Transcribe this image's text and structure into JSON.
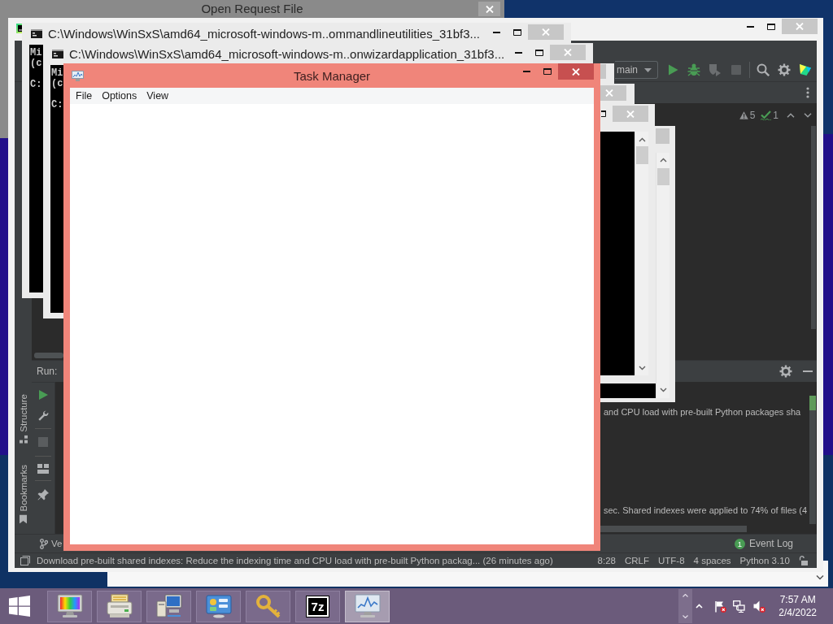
{
  "dialog_window": {
    "title": "Open Request File"
  },
  "ide": {
    "toolbar": {
      "run_config": "main"
    },
    "editor": {
      "warnings": "5",
      "typos": "1"
    },
    "tool_stripe": [
      {
        "label": "Structure"
      },
      {
        "label": "Bookmarks"
      }
    ],
    "run_panel": {
      "title": "Run:",
      "output": [
        "and CPU load with pre-built Python packages sha",
        "sec. Shared indexes were applied to 74% of files (4"
      ]
    },
    "bottom_tabs": [
      {
        "label": "Ve"
      },
      {
        "label": "Event Log",
        "badge": "1"
      }
    ],
    "status_bar": {
      "message": "Download pre-built shared indexes: Reduce the indexing time and CPU load with pre-built Python packag... (26 minutes ago)",
      "widgets": [
        "8:28",
        "CRLF",
        "UTF-8",
        "4 spaces",
        "Python 3.10"
      ]
    }
  },
  "console_windows": [
    {
      "title": "C:\\Windows\\WinSxS\\amd64_microsoft-windows-m..ommandlineutilities_31bf3...",
      "active": false,
      "lines": [
        "Mi",
        "(c"
      ],
      "prompt": "C:"
    },
    {
      "title": "C:\\Windows\\WinSxS\\amd64_microsoft-windows-m..onwizardapplication_31bf3...",
      "active": false,
      "lines": [
        "Mi",
        "(c"
      ],
      "prompt": "C:"
    }
  ],
  "task_manager": {
    "title": "Task Manager",
    "active": true,
    "menu": [
      "File",
      "Options",
      "View"
    ]
  },
  "taskbar": {
    "buttons": [
      {
        "selected": false
      },
      {
        "selected": false
      },
      {
        "selected": false
      },
      {
        "selected": false
      },
      {
        "selected": false
      },
      {
        "label": "7z",
        "selected": false
      },
      {
        "selected": true
      }
    ],
    "clock": {
      "time": "7:57 AM",
      "date": "2/4/2022"
    }
  }
}
